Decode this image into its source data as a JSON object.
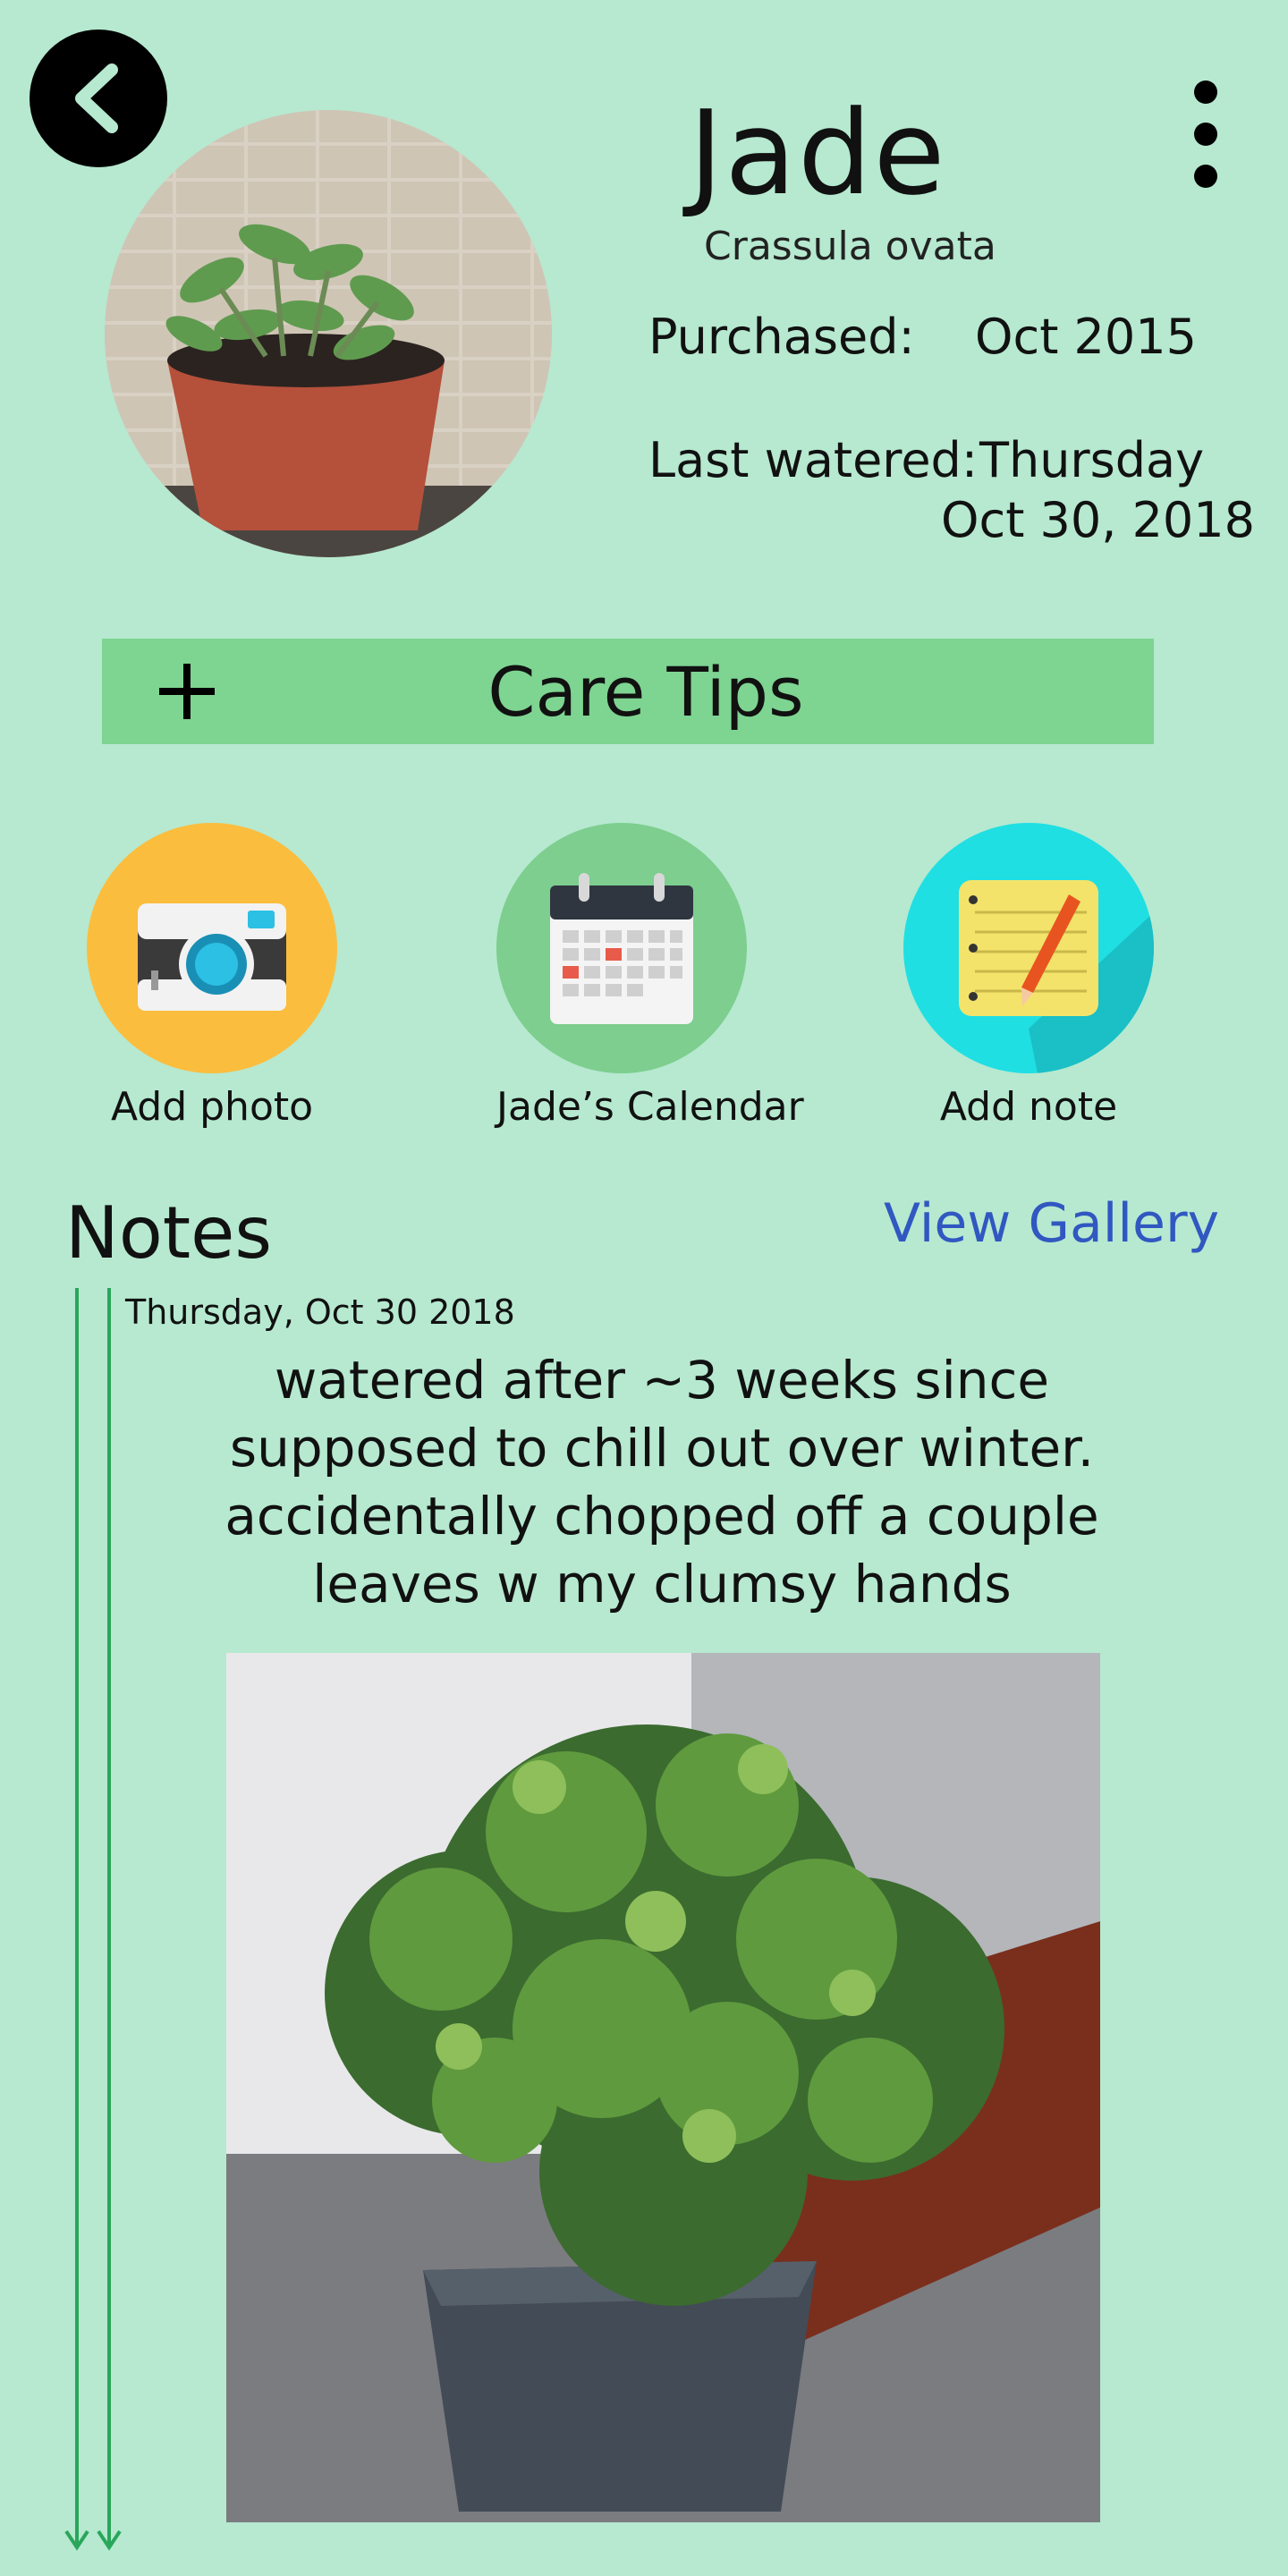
{
  "header": {
    "plant_name": "Jade",
    "species": "Crassula ovata"
  },
  "info": {
    "purchased_label": "Purchased:",
    "purchased_value": "Oct 2015",
    "watered_label": "Last watered:",
    "watered_day": "Thursday",
    "watered_date": "Oct 30, 2018"
  },
  "care_tips": {
    "label": "Care Tips",
    "icon": "plus-icon"
  },
  "actions": [
    {
      "label": "Add photo",
      "icon": "camera-icon",
      "color": "#fbbd3e"
    },
    {
      "label": "Jade’s Calendar",
      "icon": "calendar-icon",
      "color": "#7dce8f"
    },
    {
      "label": "Add note",
      "icon": "notepad-icon",
      "color": "#1fdfe3"
    }
  ],
  "notes": {
    "heading": "Notes",
    "view_gallery_label": "View Gallery",
    "entries": [
      {
        "date": "Thursday, Oct 30 2018",
        "text": "watered after ~3 weeks since supposed to chill out over winter. accidentally chopped off a couple leaves w my clumsy hands"
      }
    ]
  },
  "colors": {
    "background": "#b6e9d0",
    "care_tips_bar": "#7ed491",
    "link": "#3157c1",
    "timeline": "#2aa65a"
  }
}
